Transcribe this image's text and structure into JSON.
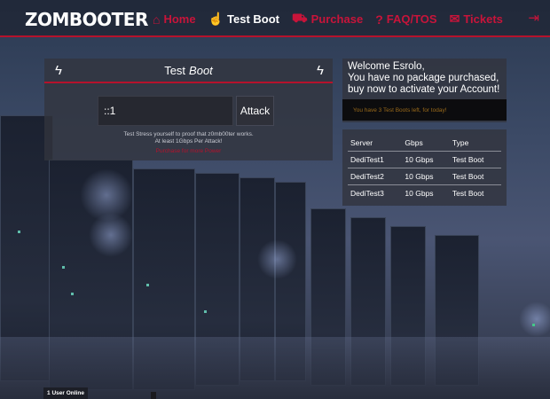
{
  "header": {
    "logo": "ZOMBOOTER",
    "nav": [
      {
        "label": "Home",
        "icon": "home-icon"
      },
      {
        "label": "Test Boot",
        "icon": "hand-pointer-icon"
      },
      {
        "label": "Purchase",
        "icon": "cart-icon"
      },
      {
        "label": "FAQ/TOS",
        "icon": "question-circle-icon"
      },
      {
        "label": "Tickets",
        "icon": "ticket-icon"
      }
    ],
    "logout_icon": "sign-out-icon"
  },
  "test_boot": {
    "title_plain": "Test",
    "title_italic": "Boot",
    "target_value": "::1",
    "attack_label": "Attack",
    "info_line1": "Test Stress yourself to proof that z0mb00ter works.",
    "info_line2": "At least 1Gbps Per Attack!",
    "info_link": "Purchase for more Power"
  },
  "welcome": {
    "line1": "Welcome Esrolo,",
    "line2": "You have no package purchased,",
    "line3": "buy now to activate your Account!",
    "boots_left": "You have 3 Test Boots left, for today!"
  },
  "servers": {
    "headers": [
      "Server",
      "Gbps",
      "Type"
    ],
    "rows": [
      [
        "DediTest1",
        "10 Gbps",
        "Test Boot"
      ],
      [
        "DediTest2",
        "10 Gbps",
        "Test Boot"
      ],
      [
        "DediTest3",
        "10 Gbps",
        "Test Boot"
      ]
    ]
  },
  "footer": {
    "online": "1 User Online"
  },
  "colors": {
    "accent": "#c8143a",
    "panel": "#32343e"
  }
}
